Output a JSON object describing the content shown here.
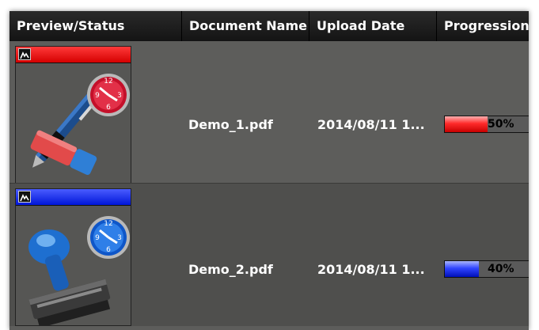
{
  "columns": {
    "preview_status": "Preview/Status",
    "document_name": "Document Name",
    "upload_date": "Upload Date",
    "progression": "Progression"
  },
  "rows": [
    {
      "status_color": "#e00000",
      "thumbnail": "pen-eraser-clock-icon",
      "document_name": "Demo_1.pdf",
      "upload_date": "2014/08/11 1...",
      "progress": 0.5,
      "progress_label": "50%"
    },
    {
      "status_color": "#1a2cff",
      "thumbnail": "stamp-clock-icon",
      "document_name": "Demo_2.pdf",
      "upload_date": "2014/08/11 1...",
      "progress": 0.4,
      "progress_label": "40%"
    }
  ]
}
